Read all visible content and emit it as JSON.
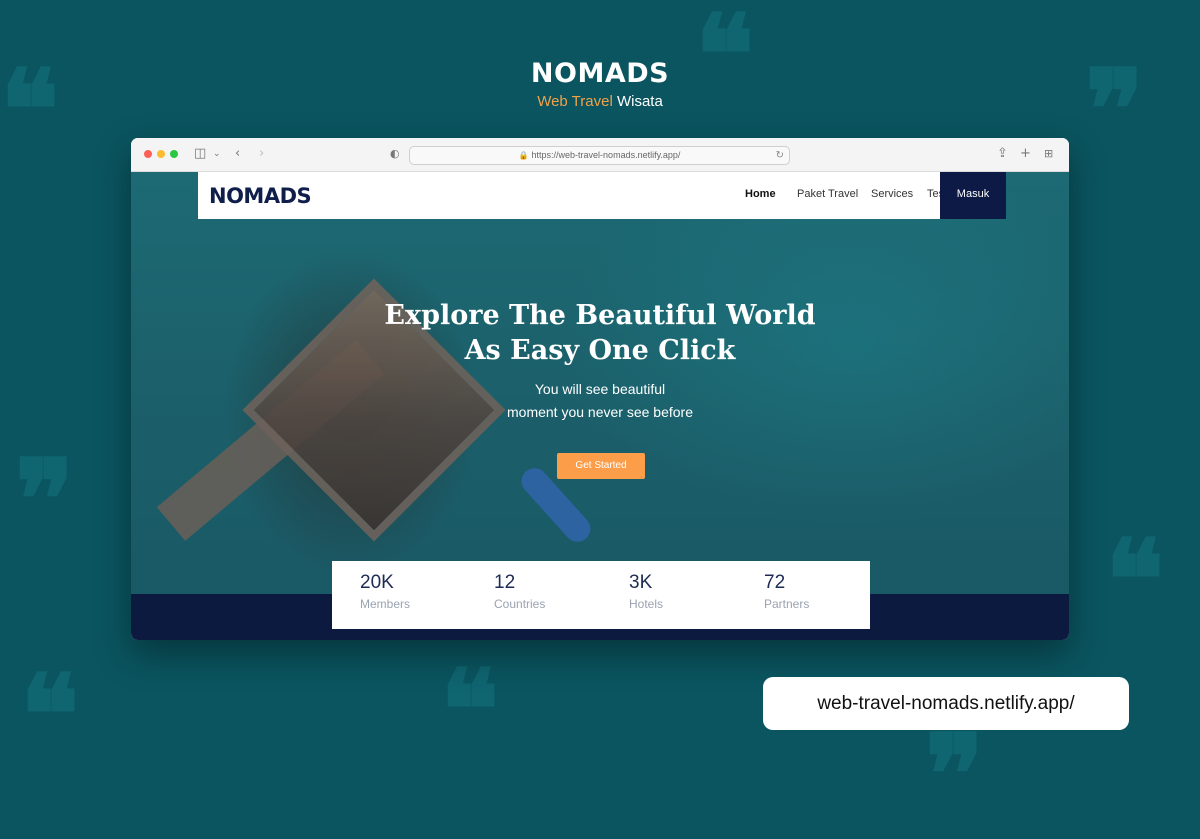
{
  "header": {
    "title": "NOMADS",
    "subtitle_accent": "Web Travel",
    "subtitle_rest": " Wisata"
  },
  "browser": {
    "url": "https://web-travel-nomads.netlify.app/"
  },
  "site": {
    "logo": "NOMADS",
    "nav": {
      "home": "Home",
      "paket": "Paket Travel",
      "services": "Services",
      "testimonial": "Testimonial",
      "login": "Masuk"
    },
    "hero": {
      "title_line1": "Explore The Beautiful World",
      "title_line2": "As Easy One Click",
      "sub_line1": "You will see beautiful",
      "sub_line2": "moment you never see before",
      "cta": "Get Started"
    },
    "stats": [
      {
        "value": "20K",
        "label": "Members"
      },
      {
        "value": "12",
        "label": "Countries"
      },
      {
        "value": "3K",
        "label": "Hotels"
      },
      {
        "value": "72",
        "label": "Partners"
      }
    ]
  },
  "footer_url": "web-travel-nomads.netlify.app/",
  "colors": {
    "background": "#0a5560",
    "accent": "#f0a24a",
    "navy": "#0c1a45",
    "cta": "#fc9d4a"
  },
  "icons": {
    "decor": "quote-mark-icon",
    "sidebar": "sidebar-toggle-icon",
    "back": "chevron-left-icon",
    "forward": "chevron-right-icon",
    "shield": "privacy-shield-icon",
    "lock": "lock-icon",
    "reload": "reload-icon",
    "share": "share-icon",
    "newtab": "plus-icon",
    "tabs": "tab-overview-icon"
  }
}
